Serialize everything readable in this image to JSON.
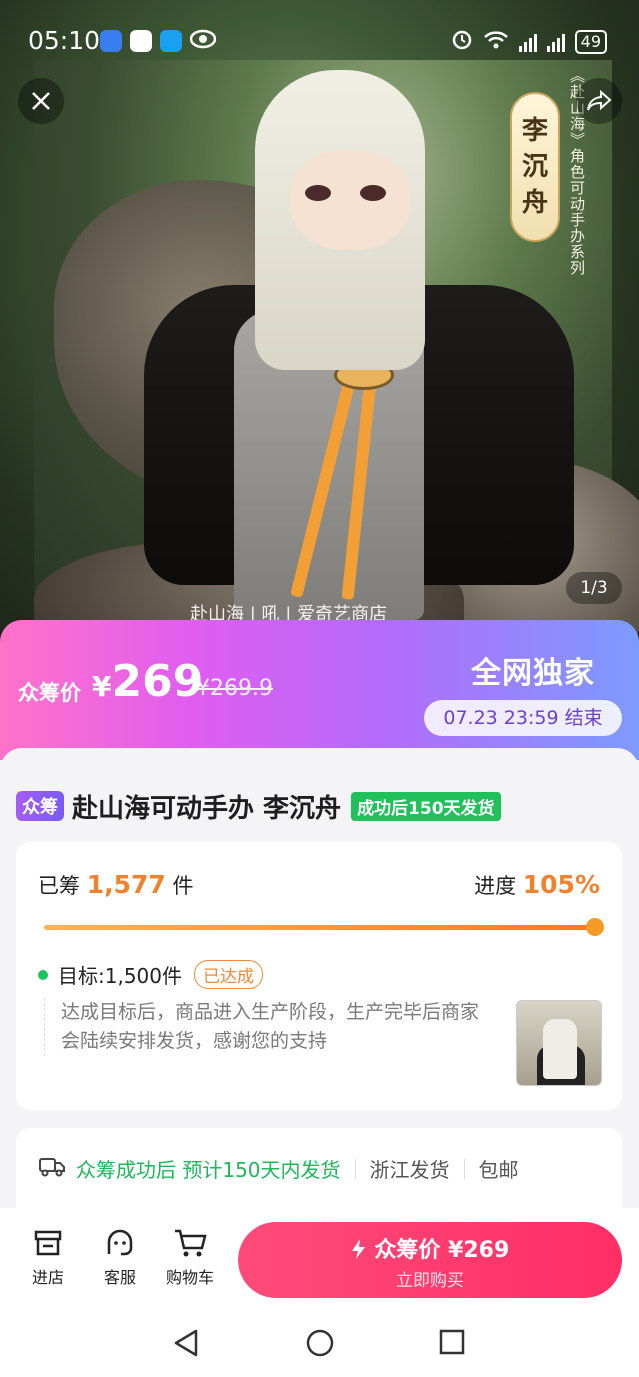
{
  "status_bar": {
    "time": "05:10",
    "battery": "49"
  },
  "hero": {
    "character_name_chars": [
      "李",
      "沉",
      "舟"
    ],
    "series_text": "《赴山海》角色可动手办系列",
    "image_counter": "1/3",
    "brand_strip": "赴山海 | 吼 | 爱奇艺商店"
  },
  "price_banner": {
    "label": "众筹价",
    "currency": "¥",
    "price": "269",
    "original_price": "¥269.9",
    "exclusive": "全网独家",
    "end_time": "07.23 23:59 结束"
  },
  "product": {
    "tag": "众筹",
    "title": "赴山海可动手办 李沉舟",
    "shipping_tag": "成功后150天发货"
  },
  "progress": {
    "raised_prefix": "已筹",
    "raised_count": "1,577",
    "raised_unit": "件",
    "progress_label": "进度",
    "progress_value": "105%",
    "progress_fraction": 1.0,
    "goal_text": "目标:1,500件",
    "goal_badge": "已达成",
    "description": "达成目标后，商品进入生产阶段，生产完毕后商家会陆续安排发货，感谢您的支持"
  },
  "shipping": {
    "estimate": "众筹成功后 预计150天内发货",
    "origin": "浙江发货",
    "free_shipping": "包邮"
  },
  "bottom_bar": {
    "store": "进店",
    "service": "客服",
    "cart": "购物车",
    "buy_main": "众筹价 ¥269",
    "buy_sub": "立即购买"
  },
  "colors": {
    "accent_orange": "#f0822d",
    "buy_button": "#ff2e64",
    "green": "#1cb85a",
    "purple": "#7a5af5"
  }
}
